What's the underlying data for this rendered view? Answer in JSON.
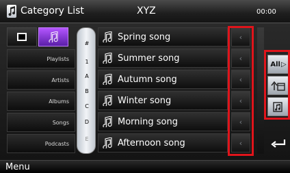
{
  "header": {
    "app_title": "Category List",
    "screen_title": "XYZ",
    "clock": "00:00"
  },
  "categories": [
    "Playlists",
    "Artists",
    "Albums",
    "Songs",
    "Podcasts"
  ],
  "index_letters": [
    "#",
    "1",
    "A",
    "B",
    "C",
    "D",
    "E"
  ],
  "songs": [
    "Spring song",
    "Summer song",
    "Autumn song",
    "Winter song",
    "Morning song",
    "Afternoon song"
  ],
  "row_arrow_icon": "‹",
  "side_buttons": {
    "all": "All",
    "up_icon": "folder-up-icon",
    "music_icon": "music-file-icon"
  },
  "footer": {
    "menu_label": "Menu"
  },
  "colors": {
    "highlight": "#e0141b",
    "accent_purple": "#8a3bd6"
  }
}
